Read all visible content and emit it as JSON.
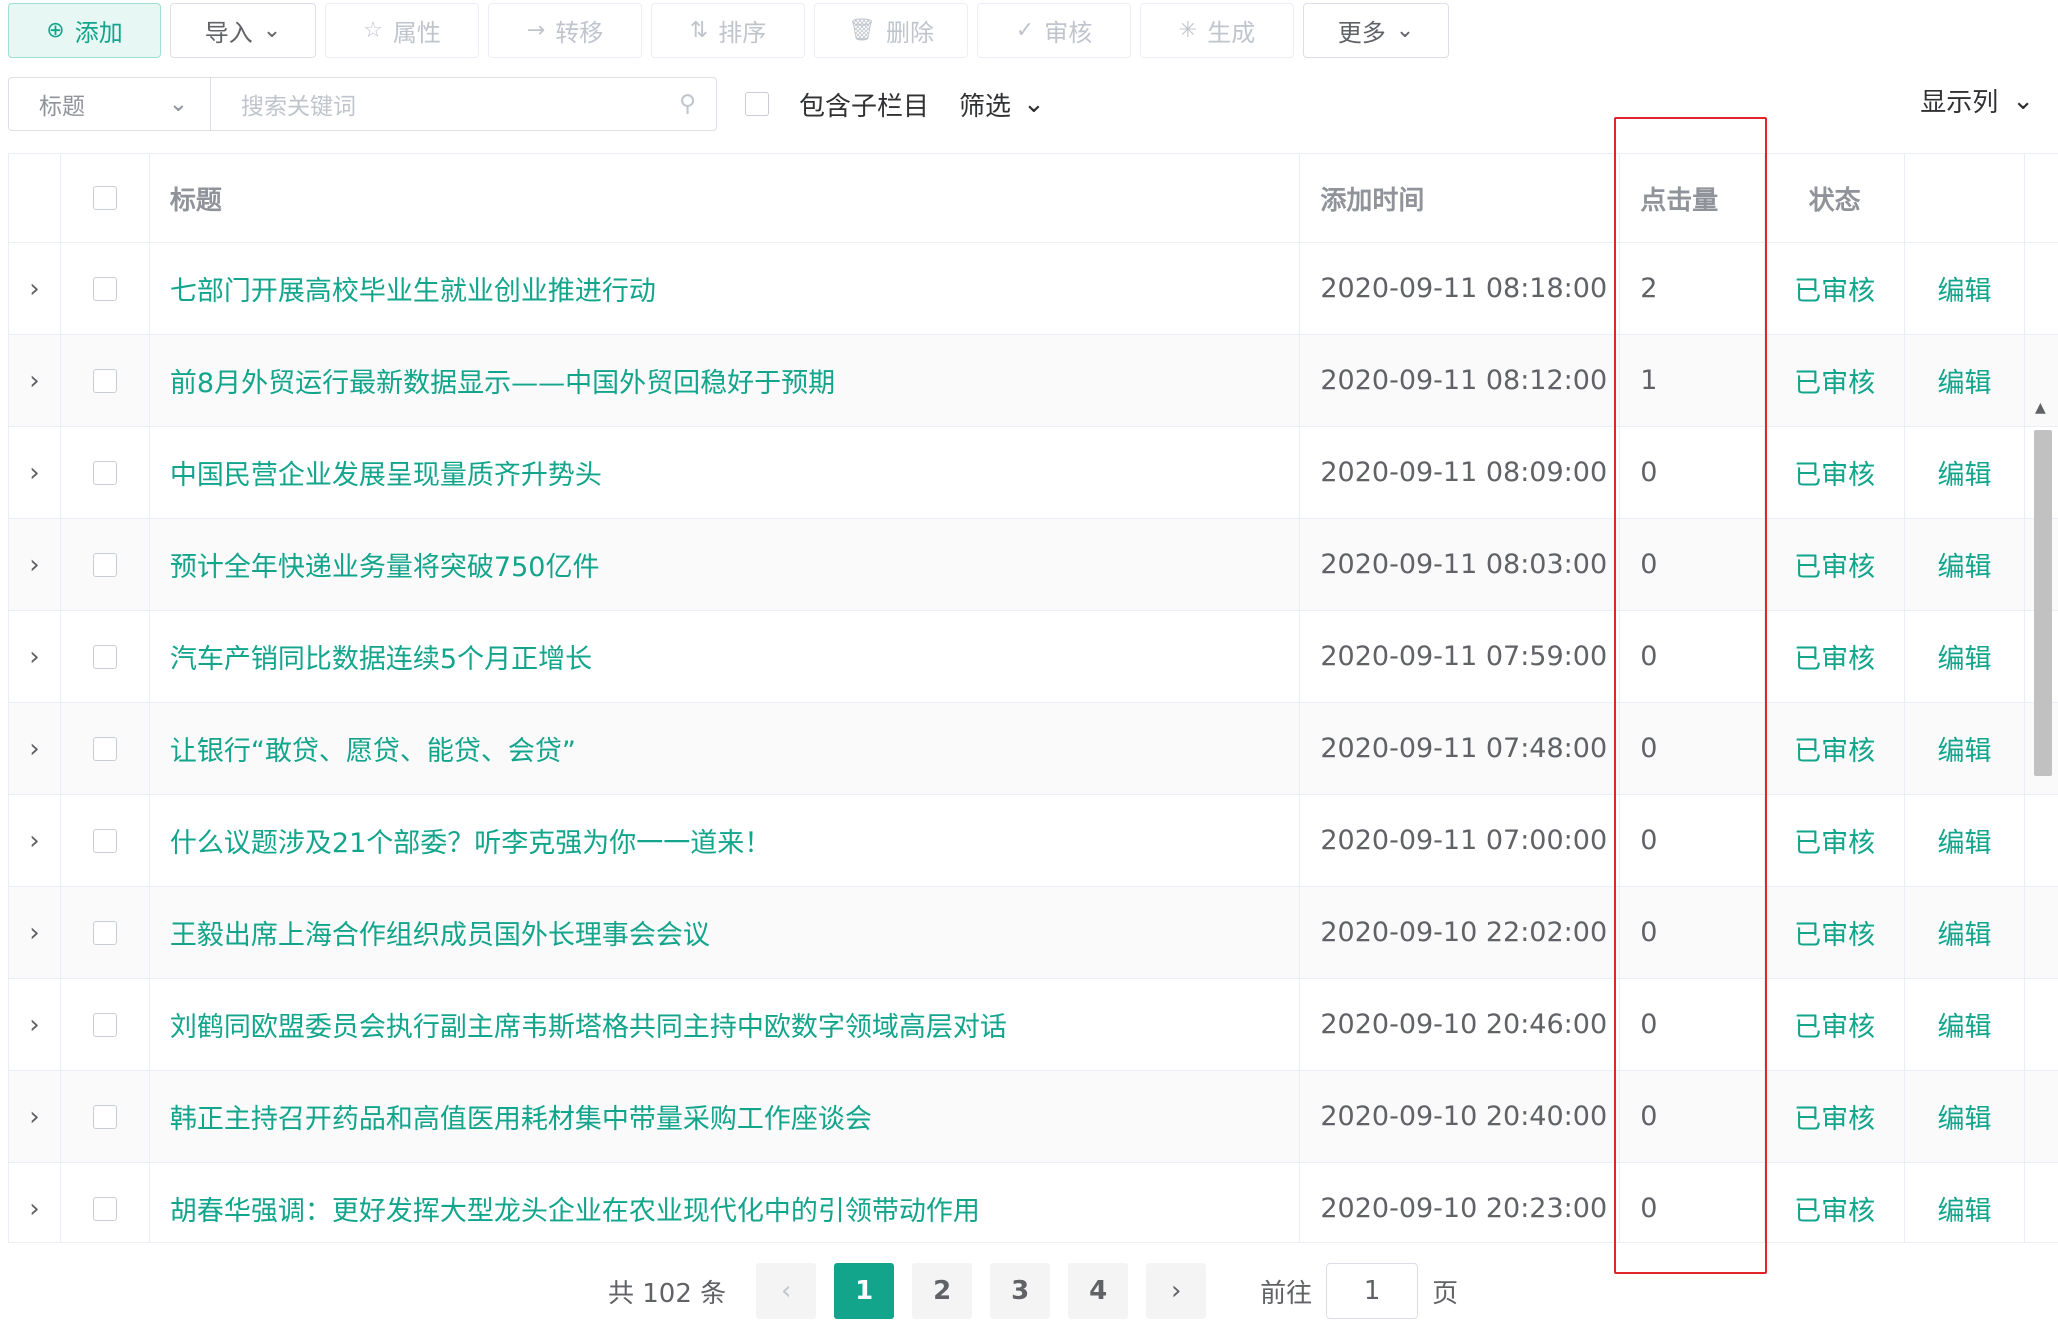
{
  "toolbar": {
    "add": "添加",
    "import": "导入",
    "attributes": "属性",
    "transfer": "转移",
    "sort": "排序",
    "delete": "删除",
    "review": "审核",
    "generate": "生成",
    "more": "更多"
  },
  "search": {
    "field_select": "标题",
    "placeholder": "搜索关键词",
    "include_sub": "包含子栏目",
    "filter": "筛选",
    "display_columns": "显示列"
  },
  "table": {
    "headers": {
      "title": "标题",
      "added_time": "添加时间",
      "hits": "点击量",
      "status": "状态"
    },
    "rows": [
      {
        "title": "七部门开展高校毕业生就业创业推进行动",
        "time": "2020-09-11 08:18:00",
        "hits": "2",
        "status": "已审核",
        "action": "编辑"
      },
      {
        "title": "前8月外贸运行最新数据显示——中国外贸回稳好于预期",
        "time": "2020-09-11 08:12:00",
        "hits": "1",
        "status": "已审核",
        "action": "编辑"
      },
      {
        "title": "中国民营企业发展呈现量质齐升势头",
        "time": "2020-09-11 08:09:00",
        "hits": "0",
        "status": "已审核",
        "action": "编辑"
      },
      {
        "title": "预计全年快递业务量将突破750亿件",
        "time": "2020-09-11 08:03:00",
        "hits": "0",
        "status": "已审核",
        "action": "编辑"
      },
      {
        "title": "汽车产销同比数据连续5个月正增长",
        "time": "2020-09-11 07:59:00",
        "hits": "0",
        "status": "已审核",
        "action": "编辑"
      },
      {
        "title": "让银行“敢贷、愿贷、能贷、会贷”",
        "time": "2020-09-11 07:48:00",
        "hits": "0",
        "status": "已审核",
        "action": "编辑"
      },
      {
        "title": "什么议题涉及21个部委？听李克强为你一一道来！",
        "time": "2020-09-11 07:00:00",
        "hits": "0",
        "status": "已审核",
        "action": "编辑"
      },
      {
        "title": "王毅出席上海合作组织成员国外长理事会会议",
        "time": "2020-09-10 22:02:00",
        "hits": "0",
        "status": "已审核",
        "action": "编辑"
      },
      {
        "title": "刘鹤同欧盟委员会执行副主席韦斯塔格共同主持中欧数字领域高层对话",
        "time": "2020-09-10 20:46:00",
        "hits": "0",
        "status": "已审核",
        "action": "编辑"
      },
      {
        "title": "韩正主持召开药品和高值医用耗材集中带量采购工作座谈会",
        "time": "2020-09-10 20:40:00",
        "hits": "0",
        "status": "已审核",
        "action": "编辑"
      },
      {
        "title": "胡春华强调：更好发挥大型龙头企业在农业现代化中的引领带动作用",
        "time": "2020-09-10 20:23:00",
        "hits": "0",
        "status": "已审核",
        "action": "编辑"
      }
    ]
  },
  "pagination": {
    "total": "共 102 条",
    "pages": [
      "1",
      "2",
      "3",
      "4"
    ],
    "current": "1",
    "goto_prefix": "前往",
    "goto_value": "1",
    "goto_suffix": "页"
  },
  "colors": {
    "accent": "#13a58c",
    "highlight": "#e0262b"
  }
}
